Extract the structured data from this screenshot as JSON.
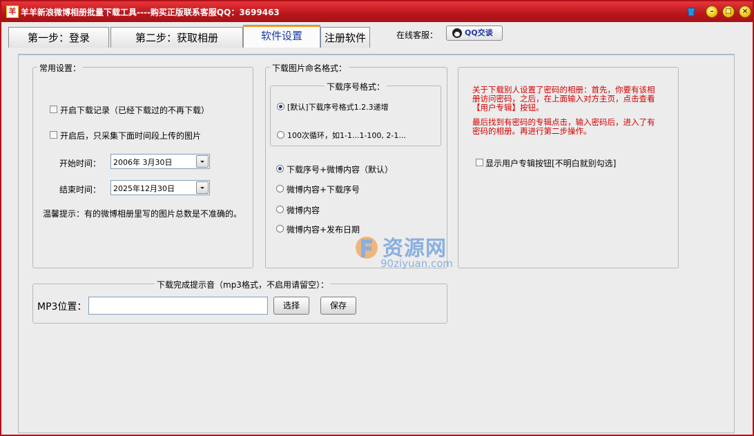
{
  "window": {
    "title": "羊羊新浪微博相册批量下载工具----购买正版联系客服QQ：3699463",
    "icon_glyph": "羊",
    "controls": [
      "skin-icon",
      "minimize-icon",
      "maximize-icon",
      "close-icon"
    ]
  },
  "tabs": [
    {
      "label": "第一步：登录",
      "active": false
    },
    {
      "label": "第二步：获取相册",
      "active": false
    },
    {
      "label": "软件设置",
      "active": true
    },
    {
      "label": "注册软件",
      "active": false
    }
  ],
  "service": {
    "label": "在线客服：",
    "qq_button": "QQ交谈"
  },
  "common": {
    "legend": "常用设置：",
    "cb_record": "开启下载记录（已经下载过的不再下载）",
    "cb_period": "开启后，只采集下面时间段上传的图片",
    "start_label": "开始时间：",
    "start_value": "2006年  3月30日",
    "end_label": "结束时间：",
    "end_value": "2025年12月30日",
    "tip": "温馨提示：有的微博相册里写的图片总数是不准确的。"
  },
  "naming": {
    "legend": "下载图片命名格式：",
    "seq_legend": "下载序号格式：",
    "seq_opt1": "[默认]下载序号格式1.2.3递增",
    "seq_opt2": "100次循环，如1-1...1-100, 2-1...",
    "opt1": "下载序号+微博内容（默认）",
    "opt2": "微博内容+下载序号",
    "opt3": "微博内容",
    "opt4": "微博内容+发布日期"
  },
  "password": {
    "red_text_1a": "关于下载别人设置了密码的相册：首先，你要有该相",
    "red_text_1b": "册访问密码，之后，在上面输入对方主页，点击查看",
    "red_text_1c": "【用户专辑】按钮。",
    "red_text_2a": "最后找到有密码的专辑点击，输入密码后，进入了有",
    "red_text_2b": "密码的相册。再进行第二步操作。",
    "cb_show": "显示用户专辑按钮[不明白就别勾选]"
  },
  "sound": {
    "legend": "下载完成提示音（mp3格式，不启用请留空）：",
    "mp3_label": "MP3位置：",
    "mp3_value": "",
    "choose_button": "选择",
    "save_button": "保存"
  },
  "watermark": {
    "main": "资源网",
    "sub": "90ziyuan.com"
  },
  "colors": {
    "title_bar": "#c4161c",
    "red_text": "#d40000",
    "active_tab_text": "#1a3aa0"
  }
}
